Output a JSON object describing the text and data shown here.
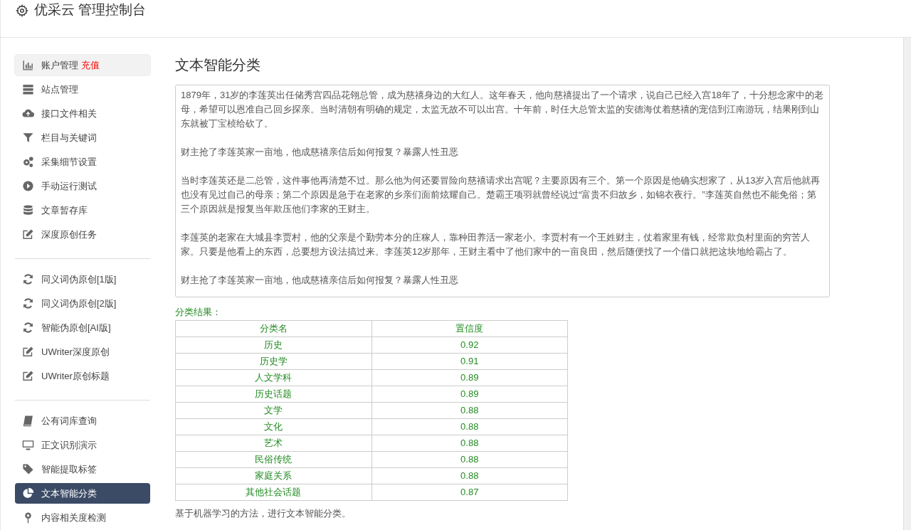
{
  "header": {
    "title": "优采云 管理控制台"
  },
  "sidebar": {
    "groups": [
      {
        "items": [
          {
            "label": "账户管理",
            "badge": "充值",
            "selected": false,
            "highlighted": true
          },
          {
            "label": "站点管理",
            "selected": false,
            "highlighted": false
          },
          {
            "label": "接口文件相关",
            "selected": false,
            "highlighted": false
          },
          {
            "label": "栏目与关键词",
            "selected": false,
            "highlighted": false
          },
          {
            "label": "采集细节设置",
            "selected": false,
            "highlighted": false
          },
          {
            "label": "手动运行测试",
            "selected": false,
            "highlighted": false
          },
          {
            "label": "文章暂存库",
            "selected": false,
            "highlighted": false
          },
          {
            "label": "深度原创任务",
            "selected": false,
            "highlighted": false
          }
        ]
      },
      {
        "items": [
          {
            "label": "同义词伪原创[1版]",
            "selected": false,
            "highlighted": false
          },
          {
            "label": "同义词伪原创[2版]",
            "selected": false,
            "highlighted": false
          },
          {
            "label": "智能伪原创[AI版]",
            "selected": false,
            "highlighted": false
          },
          {
            "label": "UWriter深度原创",
            "selected": false,
            "highlighted": false
          },
          {
            "label": "UWriter原创标题",
            "selected": false,
            "highlighted": false
          }
        ]
      },
      {
        "items": [
          {
            "label": "公有词库查询",
            "selected": false,
            "highlighted": false
          },
          {
            "label": "正文识别演示",
            "selected": false,
            "highlighted": false
          },
          {
            "label": "智能提取标签",
            "selected": false,
            "highlighted": false
          },
          {
            "label": "文本智能分类",
            "selected": true,
            "highlighted": false
          },
          {
            "label": "内容相关度检测",
            "selected": false,
            "highlighted": false
          }
        ]
      }
    ]
  },
  "main": {
    "title": "文本智能分类",
    "input_paragraphs": [
      "1879年，31岁的李莲英出任储秀宫四品花翎总管，成为慈禧身边的大红人。这年春天，他向慈禧提出了一个请求，说自己已经入宫18年了，十分想念家中的老母，希望可以恩准自己回乡探亲。当时清朝有明确的规定，太监无故不可以出宫。十年前，时任大总管太监的安德海仗着慈禧的宠信到江南游玩，结果刚到山东就被丁宝桢给砍了。",
      "财主抢了李莲英家一亩地，他成慈禧亲信后如何报复？暴露人性丑恶",
      "当时李莲英还是二总管，这件事他再清楚不过。那么他为何还要冒险向慈禧请求出宫呢？主要原因有三个。第一个原因是他确实想家了，从13岁入宫后他就再也没有见过自己的母亲；第二个原因是急于在老家的乡亲们面前炫耀自己。楚霸王项羽就曾经说过“富贵不归故乡，如锦衣夜行。”李莲英自然也不能免俗；第三个原因就是报复当年欺压他们李家的王财主。",
      "李莲英的老家在大城县李贾村，他的父亲是个勤劳本分的庄稼人，靠种田养活一家老小。李贾村有一个王姓财主，仗着家里有钱，经常欺负村里面的穷苦人家。只要是他看上的东西，总要想方设法搞过来。李莲英12岁那年，王财主看中了他们家中的一亩良田，然后随便找了一个借口就把这块地给霸占了。",
      "财主抢了李莲英家一亩地，他成慈禧亲信后如何报复？暴露人性丑恶"
    ],
    "result_label": "分类结果：",
    "table": {
      "columns": [
        "分类名",
        "置信度"
      ],
      "rows": [
        [
          "历史",
          "0.92"
        ],
        [
          "历史学",
          "0.91"
        ],
        [
          "人文学科",
          "0.89"
        ],
        [
          "历史话题",
          "0.89"
        ],
        [
          "文学",
          "0.88"
        ],
        [
          "文化",
          "0.88"
        ],
        [
          "艺术",
          "0.88"
        ],
        [
          "民俗传统",
          "0.88"
        ],
        [
          "家庭关系",
          "0.88"
        ],
        [
          "其他社会话题",
          "0.87"
        ]
      ]
    },
    "footnote": "基于机器学习的方法，进行文本智能分类。"
  }
}
